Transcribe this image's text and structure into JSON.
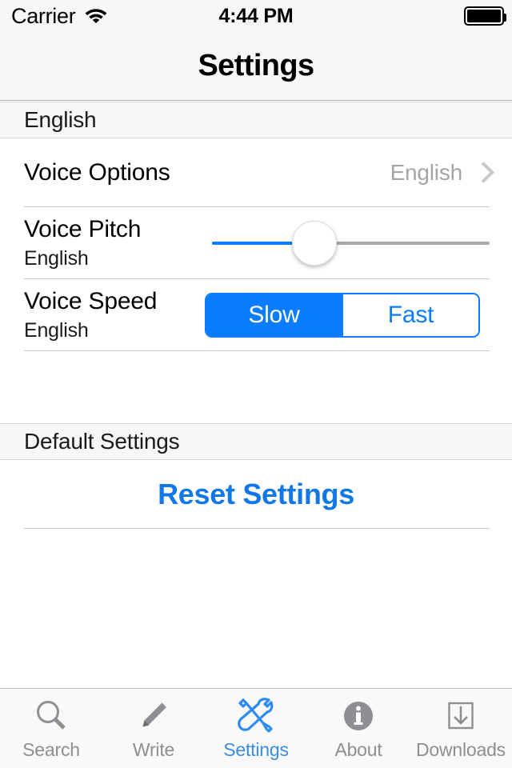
{
  "status_bar": {
    "carrier": "Carrier",
    "wifi_icon": "wifi-icon",
    "time": "4:44 PM",
    "battery_icon": "battery-full-icon"
  },
  "nav": {
    "title": "Settings"
  },
  "sections": [
    {
      "header": "English",
      "rows": {
        "voice_options": {
          "title": "Voice Options",
          "value": "English",
          "chevron_icon": "chevron-right-icon"
        },
        "voice_pitch": {
          "title": "Voice Pitch",
          "subtitle": "English",
          "slider_percent": 37
        },
        "voice_speed": {
          "title": "Voice Speed",
          "subtitle": "English",
          "segments": [
            {
              "label": "Slow",
              "selected": true
            },
            {
              "label": "Fast",
              "selected": false
            }
          ]
        }
      }
    },
    {
      "header": "Default Settings",
      "action": {
        "label": "Reset Settings"
      }
    }
  ],
  "tab_bar": {
    "tabs": [
      {
        "label": "Search",
        "icon": "magnifier-icon",
        "active": false
      },
      {
        "label": "Write",
        "icon": "pencil-icon",
        "active": false
      },
      {
        "label": "Settings",
        "icon": "tools-icon",
        "active": true
      },
      {
        "label": "About",
        "icon": "info-circle-icon",
        "active": false
      },
      {
        "label": "Downloads",
        "icon": "download-box-icon",
        "active": false
      }
    ]
  },
  "colors": {
    "accent_blue": "#0a7cff",
    "action_blue": "#1278e8",
    "active_tab_blue": "#3a8ce0",
    "inactive_gray": "#8e8e93",
    "header_bg": "#f7f7f7",
    "separator": "#c8c7cc"
  }
}
